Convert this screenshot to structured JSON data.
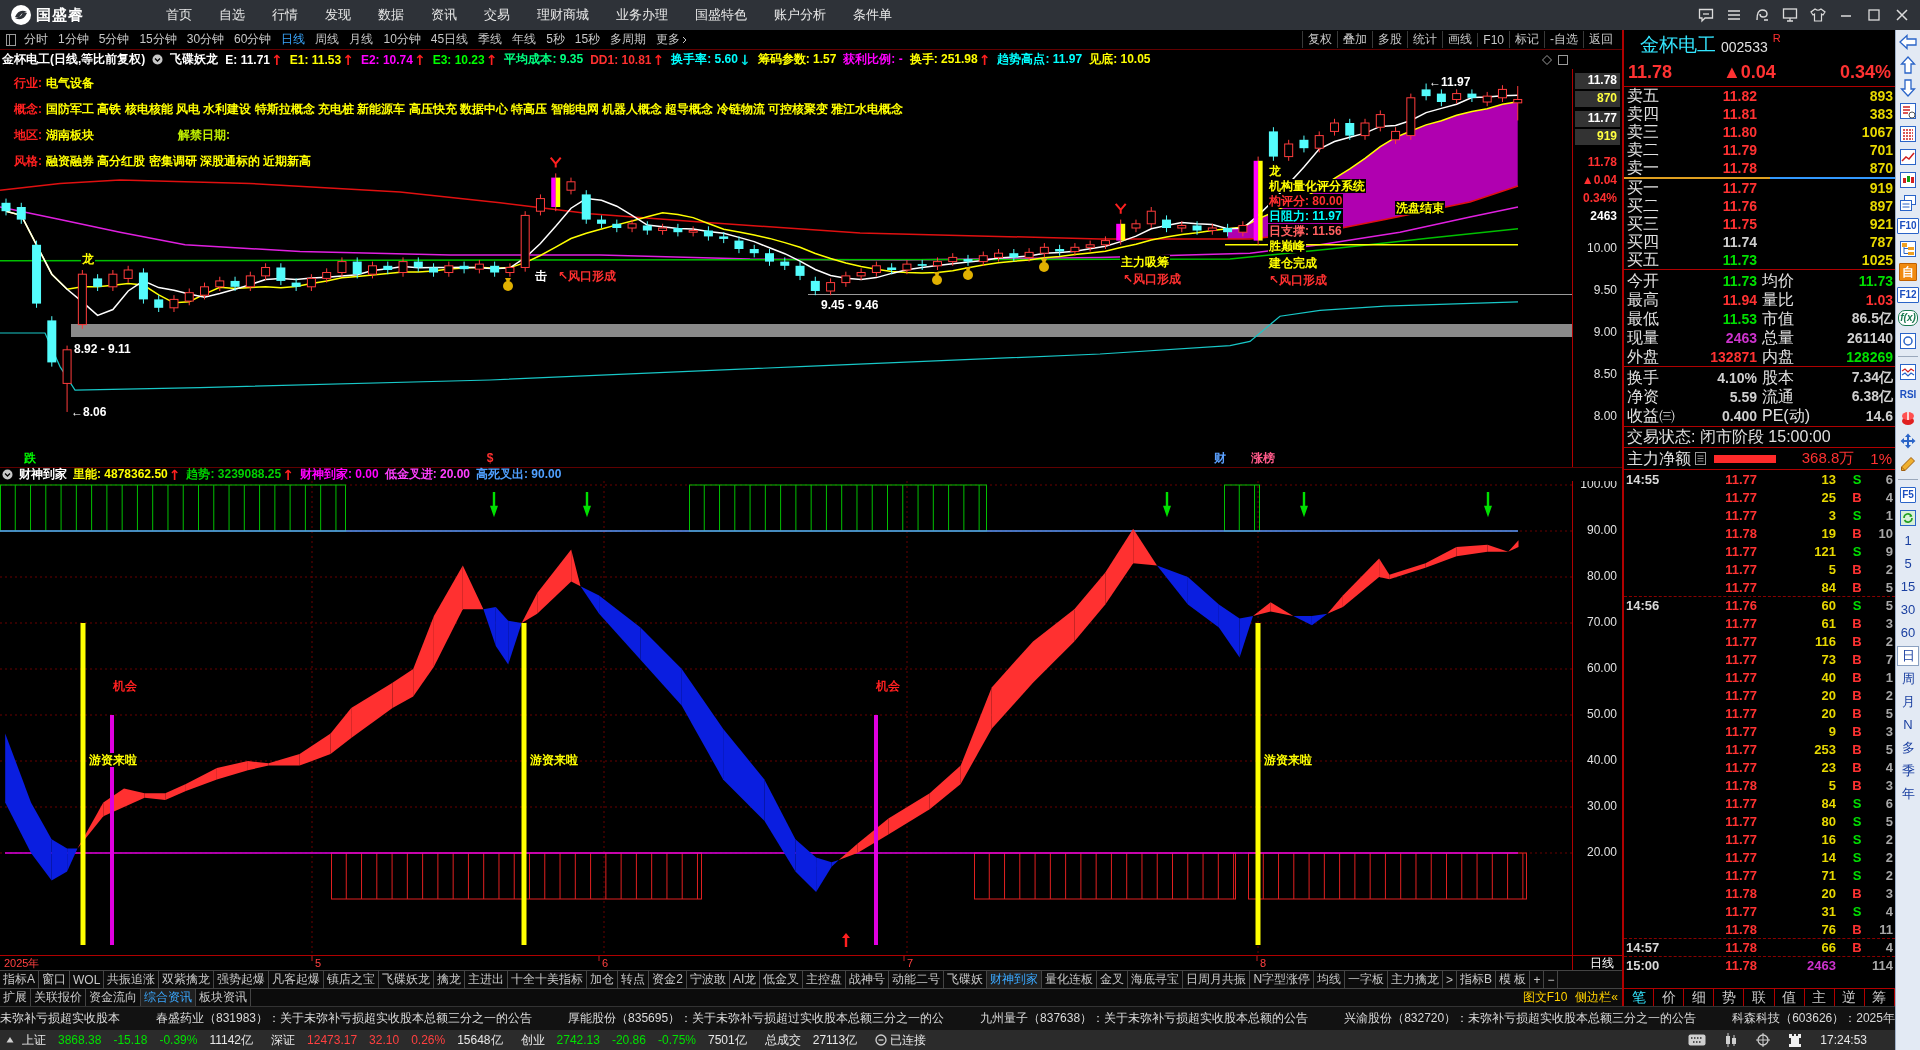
{
  "top_bar": {
    "logo_text": "国盛睿",
    "menu": [
      "首页",
      "自选",
      "行情",
      "发现",
      "数据",
      "资讯",
      "交易",
      "理财商城",
      "业务办理",
      "国盛特色",
      "账户分析",
      "条件单"
    ]
  },
  "period_bar": {
    "periods": [
      {
        "label": "分时",
        "selected": false,
        "dropdown": false
      },
      {
        "label": "1分钟",
        "selected": false,
        "dropdown": false
      },
      {
        "label": "5分钟",
        "selected": false,
        "dropdown": false
      },
      {
        "label": "15分钟",
        "selected": false,
        "dropdown": false
      },
      {
        "label": "30分钟",
        "selected": false,
        "dropdown": false
      },
      {
        "label": "60分钟",
        "selected": false,
        "dropdown": false
      },
      {
        "label": "日线",
        "selected": true,
        "dropdown": false
      },
      {
        "label": "周线",
        "selected": false,
        "dropdown": false
      },
      {
        "label": "月线",
        "selected": false,
        "dropdown": false
      },
      {
        "label": "10分钟",
        "selected": false,
        "dropdown": false
      },
      {
        "label": "45日线",
        "selected": false,
        "dropdown": false
      },
      {
        "label": "季线",
        "selected": false,
        "dropdown": false
      },
      {
        "label": "年线",
        "selected": false,
        "dropdown": false
      },
      {
        "label": "5秒",
        "selected": false,
        "dropdown": false
      },
      {
        "label": "15秒",
        "selected": false,
        "dropdown": false
      },
      {
        "label": "多周期",
        "selected": false,
        "dropdown": false
      },
      {
        "label": "更多",
        "selected": false,
        "dropdown": true
      }
    ],
    "tools": [
      "复权",
      "叠加",
      "多股",
      "统计",
      "画线",
      "F10",
      "标记",
      "-自选",
      "返回"
    ]
  },
  "info_line": {
    "title": "金杯电工(日线,等比前复权)",
    "indicator": "飞碟妖龙",
    "values": [
      {
        "text": "E: 11.71",
        "color": "#ffffff",
        "arrow": {
          "text": "↑",
          "color": "#ff2020"
        }
      },
      {
        "text": "E1: 11.53",
        "color": "#ffff00",
        "arrow": {
          "text": "↑",
          "color": "#ff2020"
        }
      },
      {
        "text": "E2: 10.74",
        "color": "#ff00ff",
        "arrow": {
          "text": "↑",
          "color": "#ff2020"
        }
      },
      {
        "text": "E3: 10.23",
        "color": "#00ff00",
        "arrow": {
          "text": "↑",
          "color": "#ff2020"
        }
      },
      {
        "text": "平均成本: 9.35",
        "color": "#00ff80"
      },
      {
        "text": "DD1: 10.81",
        "color": "#ff3030",
        "arrow": {
          "text": "↑",
          "color": "#ff2020"
        }
      },
      {
        "text": "换手率: 5.60",
        "color": "#00ffff",
        "arrow": {
          "text": "↓",
          "color": "#00e0e0"
        }
      },
      {
        "text": "筹码参数: 1.57",
        "color": "#ffff00"
      },
      {
        "text": "获利比例: -",
        "color": "#ff00ff"
      },
      {
        "text": "换手: 251.98",
        "color": "#ffff00",
        "arrow": {
          "text": "↑",
          "color": "#ff2020"
        }
      },
      {
        "text": "趋势高点: 11.97",
        "color": "#00ffff"
      },
      {
        "text": "见底: 10.05",
        "color": "#ffff00"
      }
    ]
  },
  "chart_notes": [
    {
      "label": "行业:",
      "text": "电气设备"
    },
    {
      "label": "概念:",
      "text": "国防军工 高铁 核电核能 风电 水利建设 特斯拉概念 充电桩 新能源车 高压快充 数据中心 特高压 智能电网 机器人概念 超导概念 冷链物流 可控核聚变 雅江水电概念"
    },
    {
      "label": "地区:",
      "text": "湖南板块",
      "extra": "解禁日期:"
    },
    {
      "label": "风格:",
      "text": "融资融券 高分红股 密集调研 深股通标的 近期新高"
    }
  ],
  "chart_labels": [
    {
      "text": "龙",
      "kind": "signal"
    },
    {
      "text": "8.92 - 9.11",
      "kind": "price"
    },
    {
      "text": "←8.06",
      "kind": "price"
    },
    {
      "text": "击",
      "kind": "note"
    },
    {
      "text": "↖风口形成",
      "kind": "alert"
    },
    {
      "text": "9.45 - 9.46",
      "kind": "price"
    },
    {
      "text": "主力吸筹",
      "kind": "signal"
    },
    {
      "text": "↖风口形成",
      "kind": "alert"
    },
    {
      "text": "龙",
      "kind": "signal"
    },
    {
      "text": "机构量化评分系统",
      "kind": "signal"
    },
    {
      "text": "构评分: 80.00",
      "kind": "alert"
    },
    {
      "text": "日阻力: 11.97",
      "kind": "resistance"
    },
    {
      "text": "日支撑: 11.56",
      "kind": "support"
    },
    {
      "text": "胜巅峰",
      "kind": "signal"
    },
    {
      "text": "建仓完成",
      "kind": "signal"
    },
    {
      "text": "↖风口形成",
      "kind": "alert"
    },
    {
      "text": "洗盘结束",
      "kind": "signal"
    },
    {
      "text": "←11.97",
      "kind": "price"
    },
    {
      "text": "跌",
      "kind": "down"
    },
    {
      "text": "$",
      "kind": "alert"
    },
    {
      "text": "财",
      "kind": "info"
    },
    {
      "text": "涨榜",
      "kind": "hot"
    }
  ],
  "price_axis": {
    "readouts": [
      {
        "text": "11.78",
        "kind": "quote"
      },
      {
        "text": "870",
        "kind": "size"
      },
      {
        "text": "11.77",
        "kind": "quote"
      },
      {
        "text": "919",
        "kind": "size"
      },
      {
        "text": "11.78",
        "kind": "last"
      },
      {
        "text": "▲0.04",
        "kind": "change"
      },
      {
        "text": "0.34%",
        "kind": "change"
      },
      {
        "text": "2463",
        "kind": "volume"
      }
    ],
    "ticks": [
      "10.00",
      "9.50",
      "9.00",
      "8.50",
      "8.00"
    ]
  },
  "indicator": {
    "title": "财神到家",
    "values": [
      {
        "text": "里能: 4878362.50",
        "color": "#ffff00",
        "arrow": {
          "text": "↑",
          "color": "#ff2020"
        }
      },
      {
        "text": "趋势: 3239088.25",
        "color": "#00d000",
        "arrow": {
          "text": "↑",
          "color": "#ff2020"
        }
      },
      {
        "text": "财神到家: 0.00",
        "color": "#ff00ff"
      },
      {
        "text": "低金叉进: 20.00",
        "color": "#ff40ff"
      },
      {
        "text": "高死叉出: 90.00",
        "color": "#50a0ff"
      }
    ],
    "yticks": [
      "100.00",
      "90.00",
      "80.00",
      "70.00",
      "60.00",
      "50.00",
      "40.00",
      "30.00",
      "20.00"
    ],
    "labels": [
      {
        "text": "机会",
        "kind": "chance"
      },
      {
        "text": "机会",
        "kind": "chance"
      },
      {
        "text": "游资来啦",
        "kind": "inflow"
      },
      {
        "text": "游资来啦",
        "kind": "inflow"
      },
      {
        "text": "游资来啦",
        "kind": "inflow"
      }
    ]
  },
  "date_axis": {
    "labels": [
      "2025年",
      "5",
      "6",
      "7",
      "8"
    ],
    "period": "日线"
  },
  "indicator_tabs": [
    {
      "label": "指标A",
      "selected": false
    },
    {
      "label": "窗口",
      "selected": false
    },
    {
      "label": "WOL",
      "selected": false
    },
    {
      "label": "共振追涨",
      "selected": false
    },
    {
      "label": "双紫擒龙",
      "selected": false
    },
    {
      "label": "强势起爆",
      "selected": false
    },
    {
      "label": "凡客起爆",
      "selected": false
    },
    {
      "label": "镇店之宝",
      "selected": false
    },
    {
      "label": "飞碟妖龙",
      "selected": false
    },
    {
      "label": "擒龙",
      "selected": false
    },
    {
      "label": "主进出",
      "selected": false
    },
    {
      "label": "十全十美指标",
      "selected": false
    },
    {
      "label": "加仓",
      "selected": false
    },
    {
      "label": "转点",
      "selected": false
    },
    {
      "label": "资金2",
      "selected": false
    },
    {
      "label": "宁波敢",
      "selected": false
    },
    {
      "label": "AI龙",
      "selected": false
    },
    {
      "label": "低金叉",
      "selected": false
    },
    {
      "label": "主控盘",
      "selected": false
    },
    {
      "label": "战神号",
      "selected": false
    },
    {
      "label": "动能二号",
      "selected": false
    },
    {
      "label": "飞碟妖",
      "selected": false
    },
    {
      "label": "财神到家",
      "selected": true
    },
    {
      "label": "量化连板",
      "selected": false
    },
    {
      "label": "金叉",
      "selected": false
    },
    {
      "label": "海底寻宝",
      "selected": false
    },
    {
      "label": "日周月共振",
      "selected": false
    },
    {
      "label": "N字型涨停",
      "selected": false
    },
    {
      "label": "均线",
      "selected": false
    },
    {
      "label": "一字板",
      "selected": false
    },
    {
      "label": "主力擒龙",
      "selected": false
    },
    {
      "label": ">",
      "selected": false
    },
    {
      "label": "指标B",
      "selected": false
    },
    {
      "label": "模 板",
      "selected": false
    },
    {
      "label": "+",
      "selected": false
    },
    {
      "label": "−",
      "selected": false
    }
  ],
  "panel_tabs": [
    {
      "label": "扩展",
      "selected": false
    },
    {
      "label": "关联报价",
      "selected": false
    },
    {
      "label": "资金流向",
      "selected": false
    },
    {
      "label": "综合资讯",
      "selected": true
    },
    {
      "label": "板块资讯",
      "selected": false
    }
  ],
  "panel_links": [
    "图文F10",
    "侧边栏«"
  ],
  "quote": {
    "name": "金杯电工",
    "code": "002533",
    "flag": "R",
    "price": "11.78",
    "change": "▲0.04",
    "percent": "0.34%",
    "asks": [
      {
        "label": "卖五",
        "price": "11.82",
        "volume": "893",
        "color": "#ff3232"
      },
      {
        "label": "卖四",
        "price": "11.81",
        "volume": "383",
        "color": "#ff3232"
      },
      {
        "label": "卖三",
        "price": "11.80",
        "volume": "1067",
        "color": "#ff3232"
      },
      {
        "label": "卖二",
        "price": "11.79",
        "volume": "701",
        "color": "#ff3232"
      },
      {
        "label": "卖一",
        "price": "11.78",
        "volume": "870",
        "color": "#ff3232"
      }
    ],
    "ratio_bar": {
      "level": 0.54
    },
    "bids": [
      {
        "label": "买一",
        "price": "11.77",
        "volume": "919",
        "color": "#ff3232"
      },
      {
        "label": "买二",
        "price": "11.76",
        "volume": "897",
        "color": "#ff3232"
      },
      {
        "label": "买三",
        "price": "11.75",
        "volume": "921",
        "color": "#ff3232"
      },
      {
        "label": "买四",
        "price": "11.74",
        "volume": "787",
        "color": "#d0d0d0"
      },
      {
        "label": "买五",
        "price": "11.73",
        "volume": "1025",
        "color": "#00e000"
      }
    ],
    "stats": [
      {
        "label": "今开",
        "value": "11.73",
        "color": "#00e000"
      },
      {
        "label": "均价",
        "value": "11.73",
        "color": "#00e000"
      },
      {
        "label": "最高",
        "value": "11.94",
        "color": "#ff3232"
      },
      {
        "label": "量比",
        "value": "1.03",
        "color": "#ff3232"
      },
      {
        "label": "最低",
        "value": "11.53",
        "color": "#00e000"
      },
      {
        "label": "市值",
        "value": "86.5亿",
        "color": "#d0d0d0"
      },
      {
        "label": "现量",
        "value": "2463",
        "color": "#cc33cc"
      },
      {
        "label": "总量",
        "value": "261140",
        "color": "#d0d0d0"
      },
      {
        "label": "外盘",
        "value": "132871",
        "color": "#ff3232"
      },
      {
        "label": "内盘",
        "value": "128269",
        "color": "#00e000"
      }
    ],
    "fundamentals": [
      {
        "label": "换手",
        "value": "4.10%"
      },
      {
        "label": "股本",
        "value": "7.34亿"
      },
      {
        "label": "净资",
        "value": "5.59"
      },
      {
        "label": "流通",
        "value": "6.38亿"
      },
      {
        "label": "收益㈢",
        "value": "0.400"
      },
      {
        "label": "PE(动)",
        "value": "14.6"
      }
    ],
    "status": "交易状态: 闭市阶段 15:00:00",
    "flow_label": "主力净额",
    "flow_value": "368.8万",
    "flow_percent": "1%"
  },
  "ticks": [
    {
      "time": "14:55",
      "price": "11.77",
      "volume": "13",
      "side": "S",
      "count": "6",
      "kind": "sell"
    },
    {
      "price": "11.77",
      "volume": "25",
      "side": "B",
      "count": "4",
      "kind": "buy"
    },
    {
      "price": "11.77",
      "volume": "3",
      "side": "S",
      "count": "1",
      "kind": "sell"
    },
    {
      "price": "11.78",
      "volume": "19",
      "side": "B",
      "count": "10",
      "kind": "buy"
    },
    {
      "price": "11.77",
      "volume": "121",
      "side": "S",
      "count": "9",
      "kind": "sell"
    },
    {
      "price": "11.77",
      "volume": "5",
      "side": "B",
      "count": "2",
      "kind": "buy"
    },
    {
      "price": "11.77",
      "volume": "84",
      "side": "B",
      "count": "5",
      "kind": "buy"
    },
    {
      "time": "14:56",
      "price": "11.76",
      "volume": "60",
      "side": "S",
      "count": "5",
      "kind": "sell"
    },
    {
      "price": "11.77",
      "volume": "61",
      "side": "B",
      "count": "3",
      "kind": "buy"
    },
    {
      "price": "11.77",
      "volume": "116",
      "side": "B",
      "count": "2",
      "kind": "buy"
    },
    {
      "price": "11.77",
      "volume": "73",
      "side": "B",
      "count": "7",
      "kind": "buy"
    },
    {
      "price": "11.77",
      "volume": "40",
      "side": "B",
      "count": "1",
      "kind": "buy"
    },
    {
      "price": "11.77",
      "volume": "20",
      "side": "B",
      "count": "2",
      "kind": "buy"
    },
    {
      "price": "11.77",
      "volume": "20",
      "side": "B",
      "count": "5",
      "kind": "buy"
    },
    {
      "price": "11.77",
      "volume": "9",
      "side": "B",
      "count": "3",
      "kind": "buy"
    },
    {
      "price": "11.77",
      "volume": "253",
      "side": "B",
      "count": "5",
      "kind": "buy"
    },
    {
      "price": "11.77",
      "volume": "23",
      "side": "B",
      "count": "4",
      "kind": "buy"
    },
    {
      "price": "11.78",
      "volume": "5",
      "side": "B",
      "count": "3",
      "kind": "buy"
    },
    {
      "price": "11.77",
      "volume": "84",
      "side": "S",
      "count": "6",
      "kind": "sell"
    },
    {
      "price": "11.77",
      "volume": "80",
      "side": "S",
      "count": "5",
      "kind": "sell"
    },
    {
      "price": "11.77",
      "volume": "16",
      "side": "S",
      "count": "2",
      "kind": "sell"
    },
    {
      "price": "11.77",
      "volume": "14",
      "side": "S",
      "count": "2",
      "kind": "sell"
    },
    {
      "price": "11.77",
      "volume": "71",
      "side": "S",
      "count": "2",
      "kind": "sell"
    },
    {
      "price": "11.78",
      "volume": "20",
      "side": "B",
      "count": "3",
      "kind": "buy"
    },
    {
      "price": "11.77",
      "volume": "31",
      "side": "S",
      "count": "4",
      "kind": "sell"
    },
    {
      "price": "11.78",
      "volume": "76",
      "side": "B",
      "count": "11",
      "kind": "buy"
    },
    {
      "time": "14:57",
      "price": "11.78",
      "volume": "66",
      "side": "B",
      "count": "4",
      "kind": "buy"
    },
    {
      "time": "15:00",
      "price": "11.78",
      "volume": "2463",
      "count": "114",
      "kind": "total"
    }
  ],
  "detail_tabs": [
    {
      "label": "笔",
      "selected": true
    },
    {
      "label": "价",
      "selected": false
    },
    {
      "label": "细",
      "selected": false
    },
    {
      "label": "势",
      "selected": false
    },
    {
      "label": "联",
      "selected": false
    },
    {
      "label": "值",
      "selected": false
    },
    {
      "label": "主",
      "selected": false
    },
    {
      "label": "逆",
      "selected": false
    },
    {
      "label": "筹",
      "selected": false
    }
  ],
  "side_toolbar": {
    "tool_labels": [
      "F10",
      "自",
      "F12",
      "f(x)",
      "RSI",
      "F5"
    ],
    "periods": [
      {
        "label": "1",
        "selected": false
      },
      {
        "label": "5",
        "selected": false
      },
      {
        "label": "15",
        "selected": false
      },
      {
        "label": "30",
        "selected": false
      },
      {
        "label": "60",
        "selected": false
      },
      {
        "label": "日",
        "selected": true
      },
      {
        "label": "周",
        "selected": false
      },
      {
        "label": "月",
        "selected": false
      },
      {
        "label": "N",
        "selected": false
      },
      {
        "label": "多",
        "selected": false
      },
      {
        "label": "季",
        "selected": false
      },
      {
        "label": "年",
        "selected": false
      }
    ]
  },
  "news": [
    "未弥补亏损超实收股本",
    "春盛药业（831983）：关于未弥补亏损超实收股本总额三分之一的公告",
    "厚能股份（835695）：关于未弥补亏损超过实收股本总额三分之一的公",
    "九州量子（837638）：关于未弥补亏损超实收股本总额的公告",
    "兴渝股份（832720）：未弥补亏损超实收股本总额三分之一的公告",
    "科森科技（603626）：2025年"
  ],
  "status_bar": {
    "indices": [
      {
        "name": "上证",
        "value": "3868.38",
        "change": "-15.18",
        "percent": "-0.39%",
        "amount": "11142亿",
        "color": "#00e000"
      },
      {
        "name": "深证",
        "value": "12473.17",
        "change": "32.10",
        "percent": "0.26%",
        "amount": "15648亿",
        "color": "#ff4040"
      },
      {
        "name": "创业",
        "value": "2742.13",
        "change": "-20.86",
        "percent": "-0.75%",
        "amount": "7501亿",
        "color": "#00e000"
      }
    ],
    "total_label": "总成交",
    "total": "27113亿",
    "connection": "已连接",
    "time": "17:24:53"
  }
}
